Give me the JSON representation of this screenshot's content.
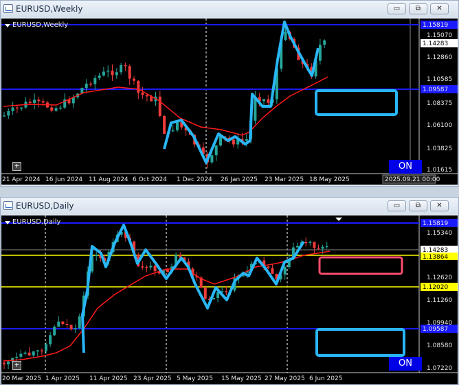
{
  "windows": [
    {
      "title": "EURUSD,Weekly",
      "chart_label": "EURUSD,Weekly",
      "date_labels": [
        "21 Apr 2024",
        "16 Jun 2024",
        "11 Aug 2024",
        "6 Oct 2024",
        "1 Dec 2024",
        "26 Jan 2025",
        "23 Mar 2025",
        "18 May 2025"
      ],
      "price_labels": [
        "1.15070",
        "1.12860",
        "1.10585",
        "1.08375",
        "1.06100",
        "1.03825",
        "1.01615"
      ],
      "current_price": "1.14283",
      "line_label_top": "1.15819",
      "line_label_mid": "1.09587",
      "crosshair_time": "2025.09.21 00:00",
      "on_label": "ON"
    },
    {
      "title": "EURUSD,Daily",
      "chart_label": "EURUSD,Daily",
      "date_labels": [
        "20 Mar 2025",
        "1 Apr 2025",
        "11 Apr 2025",
        "23 Apr 2025",
        "5 May 2025",
        "15 May 2025",
        "27 May 2025",
        "6 Jun 2025"
      ],
      "price_labels": [
        "1.15340",
        "1.12620",
        "1.11260",
        "1.09940",
        "1.08580",
        "1.07220"
      ],
      "current_price": "1.14283",
      "line_label_top": "1.15819",
      "yellow_label_1": "1.13864",
      "yellow_label_2": "1.12020",
      "line_label_low": "1.09587",
      "on_label": "ON"
    }
  ],
  "window_buttons": {
    "minimize": "▭",
    "restore": "⧉",
    "close": "✕"
  },
  "colors": {
    "bull": "#26a69a",
    "bear": "#ef3b3b",
    "ma": "#ff1a1a",
    "zigzag": "#29b6f6",
    "level_line": "#1a1aff",
    "yellow_line": "#ffff00",
    "box_blue": "#29b6f6",
    "box_pink": "#ff4d6d",
    "on_button": "#0000e6"
  }
}
